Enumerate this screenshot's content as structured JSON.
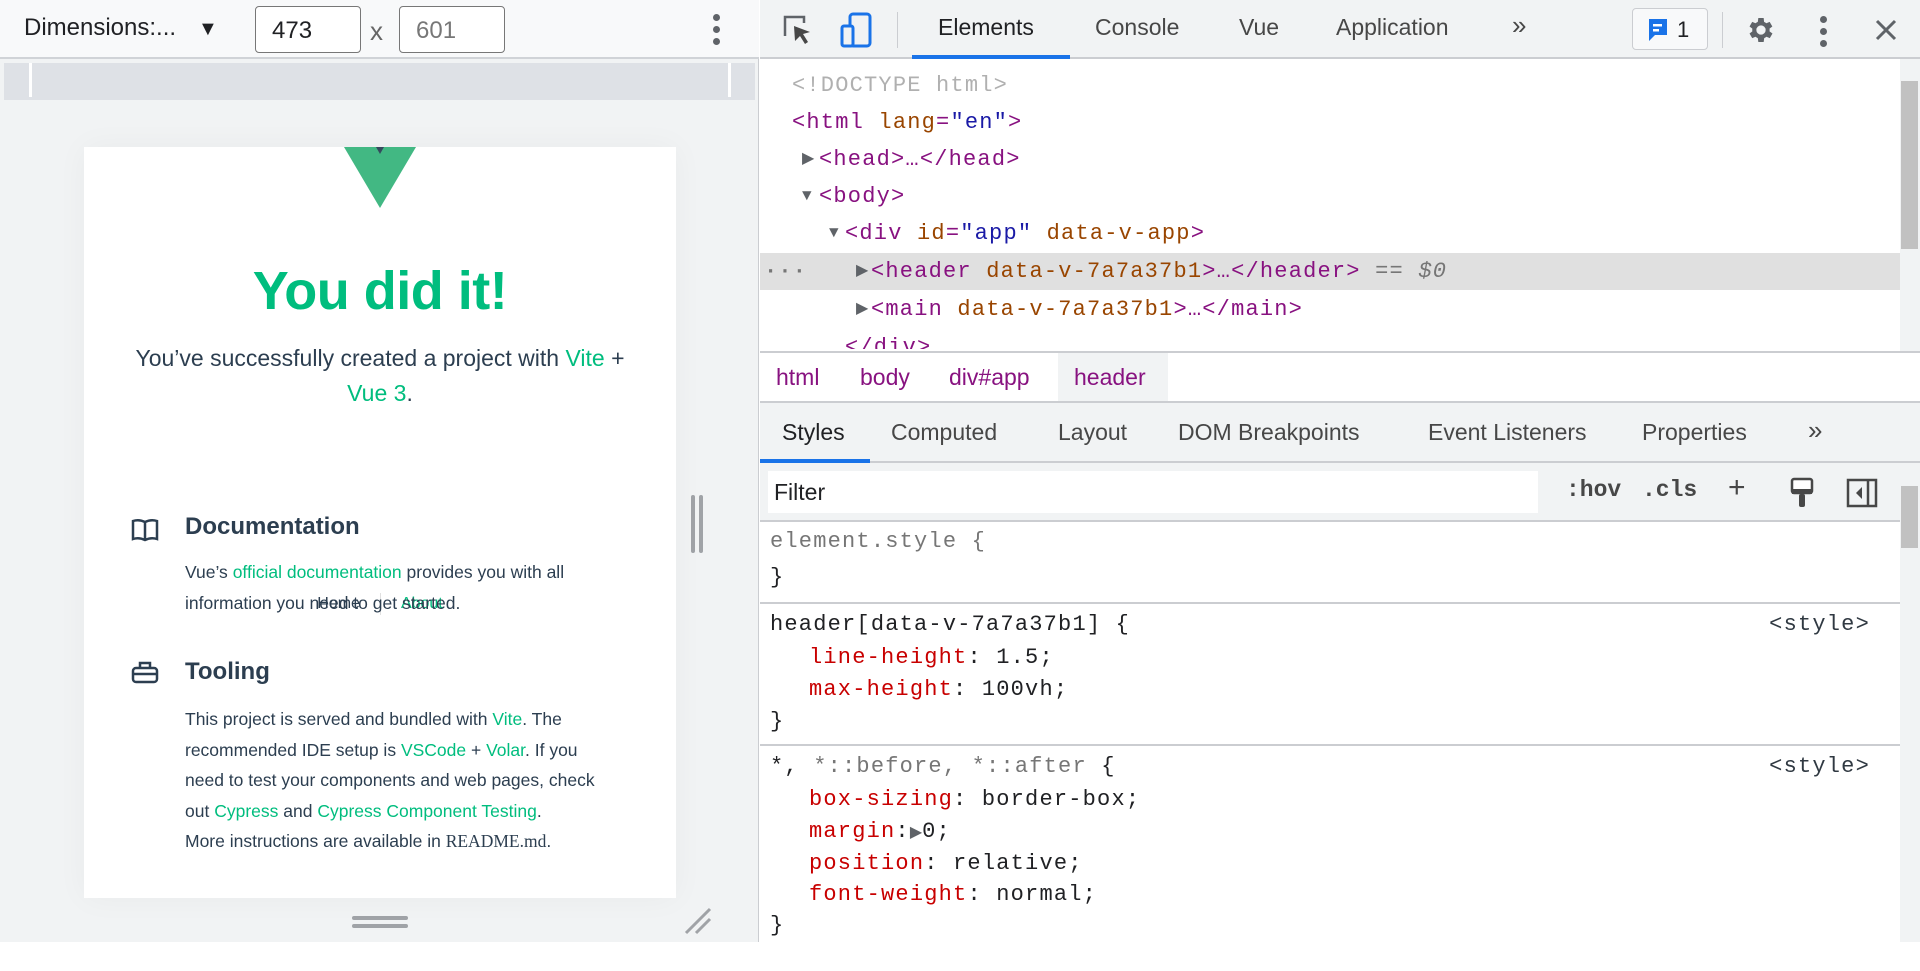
{
  "device_toolbar": {
    "dimensions_label": "Dimensions:...",
    "width": "473",
    "height": "601",
    "times": "x"
  },
  "page": {
    "title": "You did it!",
    "subtitle_pre": "You’ve successfully created a project with ",
    "subtitle_link1": "Vite",
    "subtitle_mid": " +",
    "subtitle_link2": "Vue 3",
    "subtitle_end": ".",
    "nav": [
      {
        "label": "Home"
      },
      {
        "label": "About"
      }
    ],
    "documentation": {
      "heading": "Documentation",
      "pre": "Vue’s ",
      "link": "official documentation",
      "post": " provides you with all",
      "line2": "information you need to get started."
    },
    "tooling": {
      "heading": "Tooling",
      "l1_pre": "This project is served and bundled with ",
      "l1_link": "Vite",
      "l1_post": ". The",
      "l2_pre": "recommended IDE setup is ",
      "l2_link1": "VSCode",
      "l2_mid": " + ",
      "l2_link2": "Volar",
      "l2_post": ". If you",
      "l3": "need to test your components and web pages, check",
      "l4_pre": "out ",
      "l4_link1": "Cypress",
      "l4_mid": " and ",
      "l4_link2": "Cypress Component Testing",
      "l4_post": ".",
      "l5_pre": "More instructions are available in ",
      "l5_code": "README.md",
      "l5_post": "."
    },
    "colors": {
      "accent": "#00bd7e",
      "logo": "#42b883",
      "text": "#2c3e50"
    }
  },
  "devtools": {
    "tabs": [
      {
        "label": "Elements",
        "active": true
      },
      {
        "label": "Console"
      },
      {
        "label": "Vue"
      },
      {
        "label": "Application"
      }
    ],
    "more": "»",
    "issues_count": "1",
    "dom": {
      "doctype": "<!DOCTYPE html>",
      "html_open": "<html",
      "lang_attr": "lang",
      "lang_val": "\"en\"",
      "close": ">",
      "head": "<head>…</head>",
      "body": "<body>",
      "div_open": "<div",
      "id_attr": "id",
      "id_val": "\"app\"",
      "dv_attr": "data-v-app",
      "header_open": "<header",
      "hv_attr": "data-v-7a7a37b1",
      "header_close": ">…</header>",
      "eq": "== $0",
      "main_open": "<main",
      "main_close": ">…</main>",
      "div_close": "</div>"
    },
    "breadcrumb": [
      {
        "label": "html"
      },
      {
        "label": "body"
      },
      {
        "label": "div#app"
      },
      {
        "label": "header",
        "active": true
      }
    ],
    "style_tabs": [
      {
        "label": "Styles",
        "active": true
      },
      {
        "label": "Computed"
      },
      {
        "label": "Layout"
      },
      {
        "label": "DOM Breakpoints"
      },
      {
        "label": "Event Listeners"
      },
      {
        "label": "Properties"
      }
    ],
    "filter_placeholder": "Filter",
    "hov": ":hov",
    "cls": ".cls",
    "plus": "+",
    "rules": {
      "element_style": "element.style {",
      "close": "}",
      "header_selector": "header[data-v-7a7a37b1] {",
      "source": "<style>",
      "header_props": [
        {
          "name": "line-height",
          "value": "1.5;"
        },
        {
          "name": "max-height",
          "value": "100vh;"
        }
      ],
      "star_selector": "*,",
      "star_rest": " *::before, *::after",
      "brace": " {",
      "star_props": [
        {
          "name": "box-sizing",
          "value": "border-box;"
        },
        {
          "name": "margin",
          "value": "0;"
        },
        {
          "name": "position",
          "value": "relative;"
        },
        {
          "name": "font-weight",
          "value": "normal;"
        }
      ]
    }
  }
}
